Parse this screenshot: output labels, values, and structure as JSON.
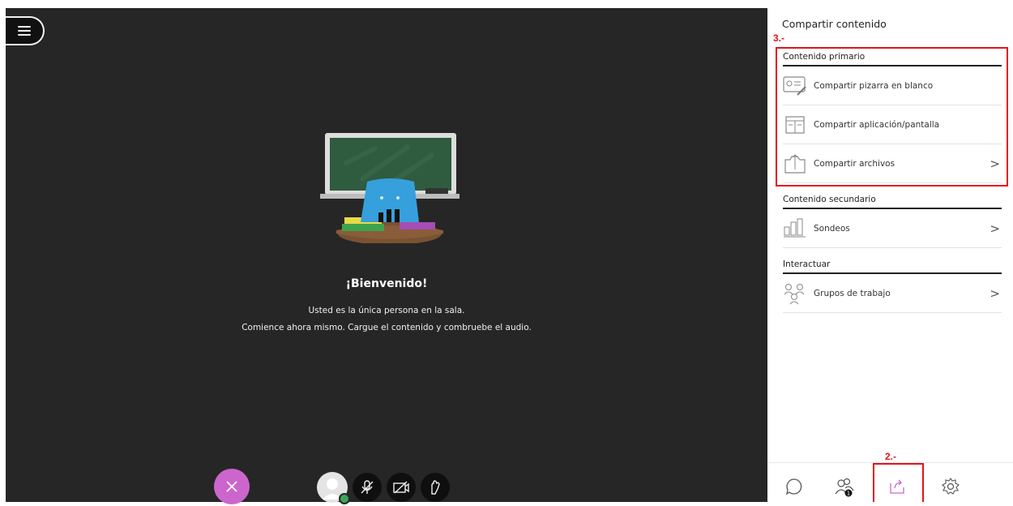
{
  "stage": {
    "welcome_title": "¡Bienvenido!",
    "line1": "Usted es la única persona en la sala.",
    "line2": "Comience ahora mismo. Cargue el contenido y combruebe el audio.",
    "controls": [
      "avatar",
      "microphone-muted-icon",
      "camera-off-icon",
      "raise-hand-icon"
    ]
  },
  "panel": {
    "title": "Compartir contenido",
    "annotation_top": "3.-",
    "annotation_bottom": "2.-",
    "sections": [
      {
        "heading": "Contenido primario",
        "items": [
          {
            "label": "Compartir pizarra en blanco",
            "icon": "whiteboard-icon"
          },
          {
            "label": "Compartir aplicación/pantalla",
            "icon": "screen-share-icon"
          },
          {
            "label": "Compartir archivos",
            "icon": "files-icon",
            "chevron": ">"
          }
        ]
      },
      {
        "heading": "Contenido secundario",
        "items": [
          {
            "label": "Sondeos",
            "icon": "polls-icon",
            "chevron": ">"
          }
        ]
      },
      {
        "heading": "Interactuar",
        "items": [
          {
            "label": "Grupos de trabajo",
            "icon": "breakout-groups-icon",
            "chevron": ">"
          }
        ]
      }
    ],
    "bottom_nav": [
      "chat-icon",
      "attendees-icon",
      "share-content-icon",
      "settings-icon",
      "close-icon"
    ],
    "attendees_badge": "1",
    "accent": "#cc66cc",
    "annotation_color": "#e3141c"
  }
}
